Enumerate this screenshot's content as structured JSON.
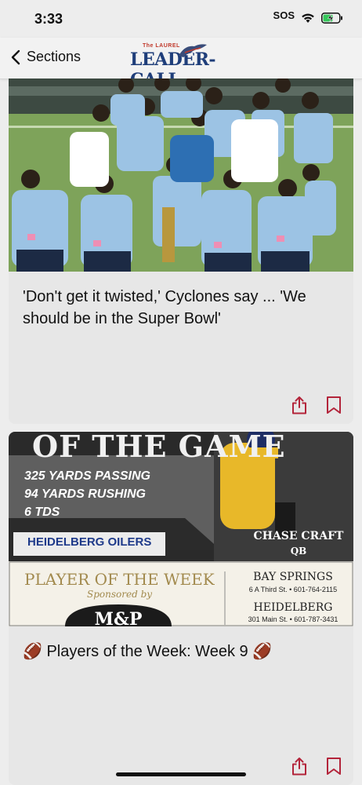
{
  "status_bar": {
    "time": "3:33",
    "sos": "SOS"
  },
  "nav": {
    "back_label": "Sections",
    "logo_small": "The LAUREL",
    "logo_main": "LEADER-CALL"
  },
  "articles": [
    {
      "headline": "'Don't get it twisted,' Cyclones say ... 'We should be in the Super Bowl'"
    },
    {
      "headline": "🏈 Players of the Week: Week 9 🏈"
    }
  ],
  "graphic": {
    "banner_title": "OF THE GAME",
    "stats": [
      "325 YARDS PASSING",
      "94 YARDS RUSHING",
      "6 TDS"
    ],
    "team": "HEIDELBERG OILERS",
    "player_name": "CHASE CRAFT",
    "player_position": "QB",
    "potw_title": "PLAYER OF THE WEEK",
    "sponsored_by": "Sponsored by",
    "sponsor_logo": "M&P",
    "location1_name": "BAY SPRINGS",
    "location1_address": "6 A Third St. • 601-764-2115",
    "location2_name": "HEIDELBERG",
    "location2_address": "301 Main St. • 601-787-3431"
  },
  "colors": {
    "accent": "#b3243a",
    "logo_blue": "#1f3e7a",
    "gold": "#e8b829"
  }
}
